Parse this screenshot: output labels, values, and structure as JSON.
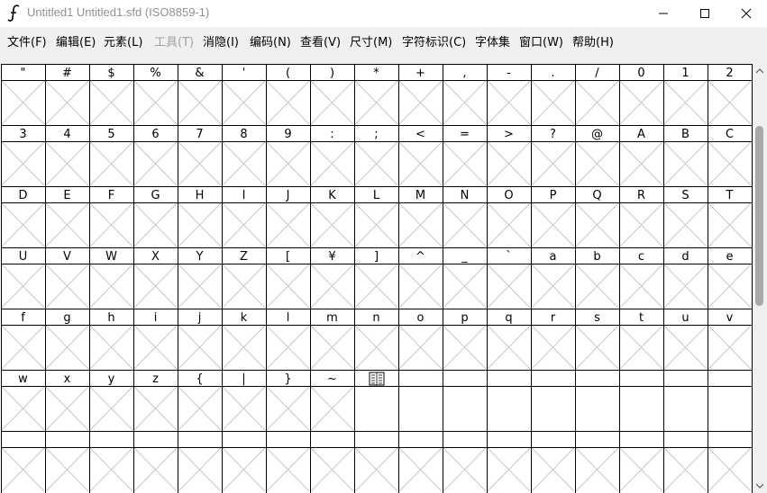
{
  "window": {
    "title": "Untitled1   Untitled1.sfd (ISO8859-1)",
    "minimize_icon": "minimize-icon",
    "maximize_icon": "maximize-icon",
    "close_icon": "close-icon",
    "app_icon": "fontforge-icon"
  },
  "menu": [
    {
      "label": "文件(F)",
      "enabled": true
    },
    {
      "label": "编辑(E)",
      "enabled": true
    },
    {
      "label": "元素(L)",
      "enabled": true
    },
    {
      "label": "工具(T)",
      "enabled": false
    },
    {
      "label": "消隐(I)",
      "enabled": true
    },
    {
      "label": "编码(N)",
      "enabled": true
    },
    {
      "label": "查看(V)",
      "enabled": true
    },
    {
      "label": "尺寸(M)",
      "enabled": true
    },
    {
      "label": "字符标识(C)",
      "enabled": true
    },
    {
      "label": "字体集",
      "enabled": true
    },
    {
      "label": "窗口(W)",
      "enabled": true
    },
    {
      "label": "帮助(H)",
      "enabled": true
    }
  ],
  "glyph_rows": [
    [
      "\"",
      "#",
      "$",
      "%",
      "&",
      "'",
      "(",
      ")",
      "*",
      "+",
      ",",
      "-",
      ".",
      "/",
      "0",
      "1",
      "2"
    ],
    [
      "3",
      "4",
      "5",
      "6",
      "7",
      "8",
      "9",
      ":",
      ";",
      "<",
      "=",
      ">",
      "?",
      "@",
      "A",
      "B",
      "C"
    ],
    [
      "D",
      "E",
      "F",
      "G",
      "H",
      "I",
      "J",
      "K",
      "L",
      "M",
      "N",
      "O",
      "P",
      "Q",
      "R",
      "S",
      "T"
    ],
    [
      "U",
      "V",
      "W",
      "X",
      "Y",
      "Z",
      "[",
      "¥",
      "]",
      "^",
      "_",
      "`",
      "a",
      "b",
      "c",
      "d",
      "e"
    ],
    [
      "f",
      "g",
      "h",
      "i",
      "j",
      "k",
      "l",
      "m",
      "n",
      "o",
      "p",
      "q",
      "r",
      "s",
      "t",
      "u",
      "v"
    ],
    [
      "w",
      "x",
      "y",
      "z",
      "{",
      "|",
      "}",
      "~",
      "",
      "",
      "",
      "",
      "",
      "",
      "",
      "",
      ""
    ],
    [
      "",
      "",
      "",
      "",
      "",
      "",
      "",
      "",
      "",
      "",
      "",
      "",
      "",
      "",
      "",
      "",
      ""
    ]
  ],
  "missing_glyph_icon": "unencoded-glyph-icon",
  "missing_glyph_cell": [
    5,
    8
  ],
  "empty_glyph_icon": "empty-glyph-cross-icon",
  "empty_cross_rows": [
    0,
    1,
    2,
    3,
    4,
    5,
    6
  ],
  "empty_cross_cols_in_row5": 8,
  "colors": {
    "grid_line": "#000000",
    "cross_line": "#c8c8c8",
    "menubar_bg": "#f0f0f0",
    "title_text": "#909090"
  },
  "scrollbar": {
    "icon_up": "scroll-up-arrow-icon",
    "icon_down": "scroll-down-arrow-icon"
  }
}
